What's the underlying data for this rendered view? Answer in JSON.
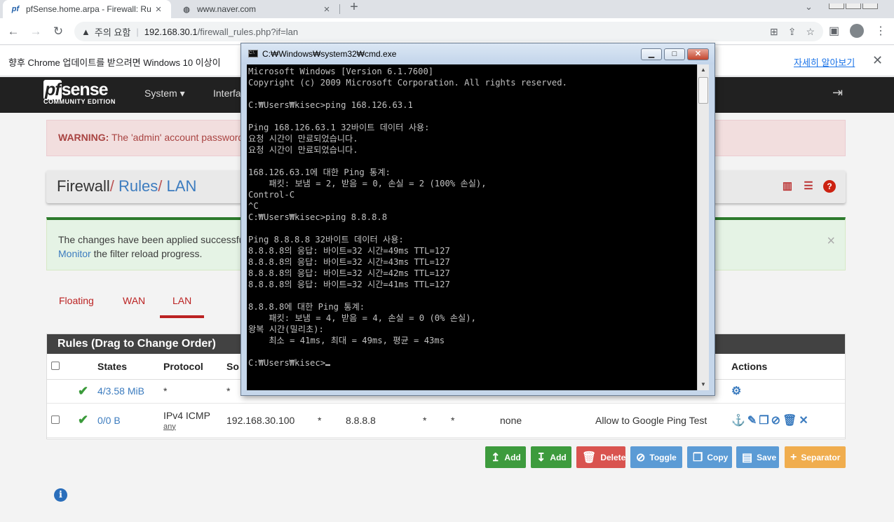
{
  "browser": {
    "tabs": [
      {
        "title": "pfSense.home.arpa - Firewall: Ru",
        "favicon": "pf"
      },
      {
        "title": "www.naver.com",
        "favicon": "globe-icon"
      }
    ],
    "address": {
      "warning_label": "주의 요함",
      "host": "192.168.30.1",
      "path": "/firewall_rules.php?if=lan"
    },
    "infobar": {
      "message": "향후 Chrome 업데이트를 받으려면 Windows 10 이상이",
      "link": "자세히 알아보기"
    }
  },
  "pfsense": {
    "logo": {
      "brand_prefix": "pf",
      "brand_suffix": "sense",
      "edition": "COMMUNITY EDITION"
    },
    "nav": [
      "System",
      "Interfa"
    ],
    "warning": {
      "label": "WARNING:",
      "text": "The 'admin' account password"
    },
    "breadcrumb": {
      "part1": "Firewall",
      "part2": "Rules",
      "part3": "LAN",
      "sep": "/"
    },
    "applied": {
      "line1": "The changes have been applied successful",
      "link": "Monitor",
      "line2_rest": " the filter reload progress."
    },
    "tabs": [
      "Floating",
      "WAN",
      "LAN"
    ],
    "rules": {
      "title": "Rules (Drag to Change Order)",
      "headers": {
        "states": "States",
        "protocol": "Protocol",
        "source": "So",
        "actions": "Actions"
      },
      "row1": {
        "states": "4/3.58 MiB",
        "protocol": "*",
        "source": "*"
      },
      "row2": {
        "states": "0/0 B",
        "protocol": "IPv4 ICMP",
        "protocol_sub": "any",
        "source": "192.168.30.100",
        "port": "*",
        "destination": "8.8.8.8",
        "dport": "*",
        "gateway": "*",
        "queue": "none",
        "description": "Allow to Google Ping Test"
      }
    },
    "buttons": {
      "add_top": "Add",
      "add_bottom": "Add",
      "delete": "Delete",
      "toggle": "Toggle",
      "copy": "Copy",
      "save": "Save",
      "separator": "Separator"
    }
  },
  "cmd": {
    "title": "C:₩Windows₩system32₩cmd.exe",
    "lines": [
      "Microsoft Windows [Version 6.1.7600]",
      "Copyright (c) 2009 Microsoft Corporation. All rights reserved.",
      "",
      "C:₩Users₩kisec>ping 168.126.63.1",
      "",
      "Ping 168.126.63.1 32바이트 데이터 사용:",
      "요청 시간이 만료되었습니다.",
      "요청 시간이 만료되었습니다.",
      "",
      "168.126.63.1에 대한 Ping 통계:",
      "    패킷: 보냄 = 2, 받음 = 0, 손실 = 2 (100% 손실),",
      "Control-C",
      "^C",
      "C:₩Users₩kisec>ping 8.8.8.8",
      "",
      "Ping 8.8.8.8 32바이트 데이터 사용:",
      "8.8.8.8의 응답: 바이트=32 시간=49ms TTL=127",
      "8.8.8.8의 응답: 바이트=32 시간=43ms TTL=127",
      "8.8.8.8의 응답: 바이트=32 시간=42ms TTL=127",
      "8.8.8.8의 응답: 바이트=32 시간=41ms TTL=127",
      "",
      "8.8.8.8에 대한 Ping 통계:",
      "    패킷: 보냄 = 4, 받음 = 4, 손실 = 0 (0% 손실),",
      "왕복 시간(밀리초):",
      "    최소 = 41ms, 최대 = 49ms, 평균 = 43ms",
      "",
      "C:₩Users₩kisec>"
    ]
  },
  "colors": {
    "pf_red": "#b22222",
    "pf_dark": "#212121",
    "link_blue": "#3c7cbf",
    "ok_green": "#3d9b3d"
  }
}
